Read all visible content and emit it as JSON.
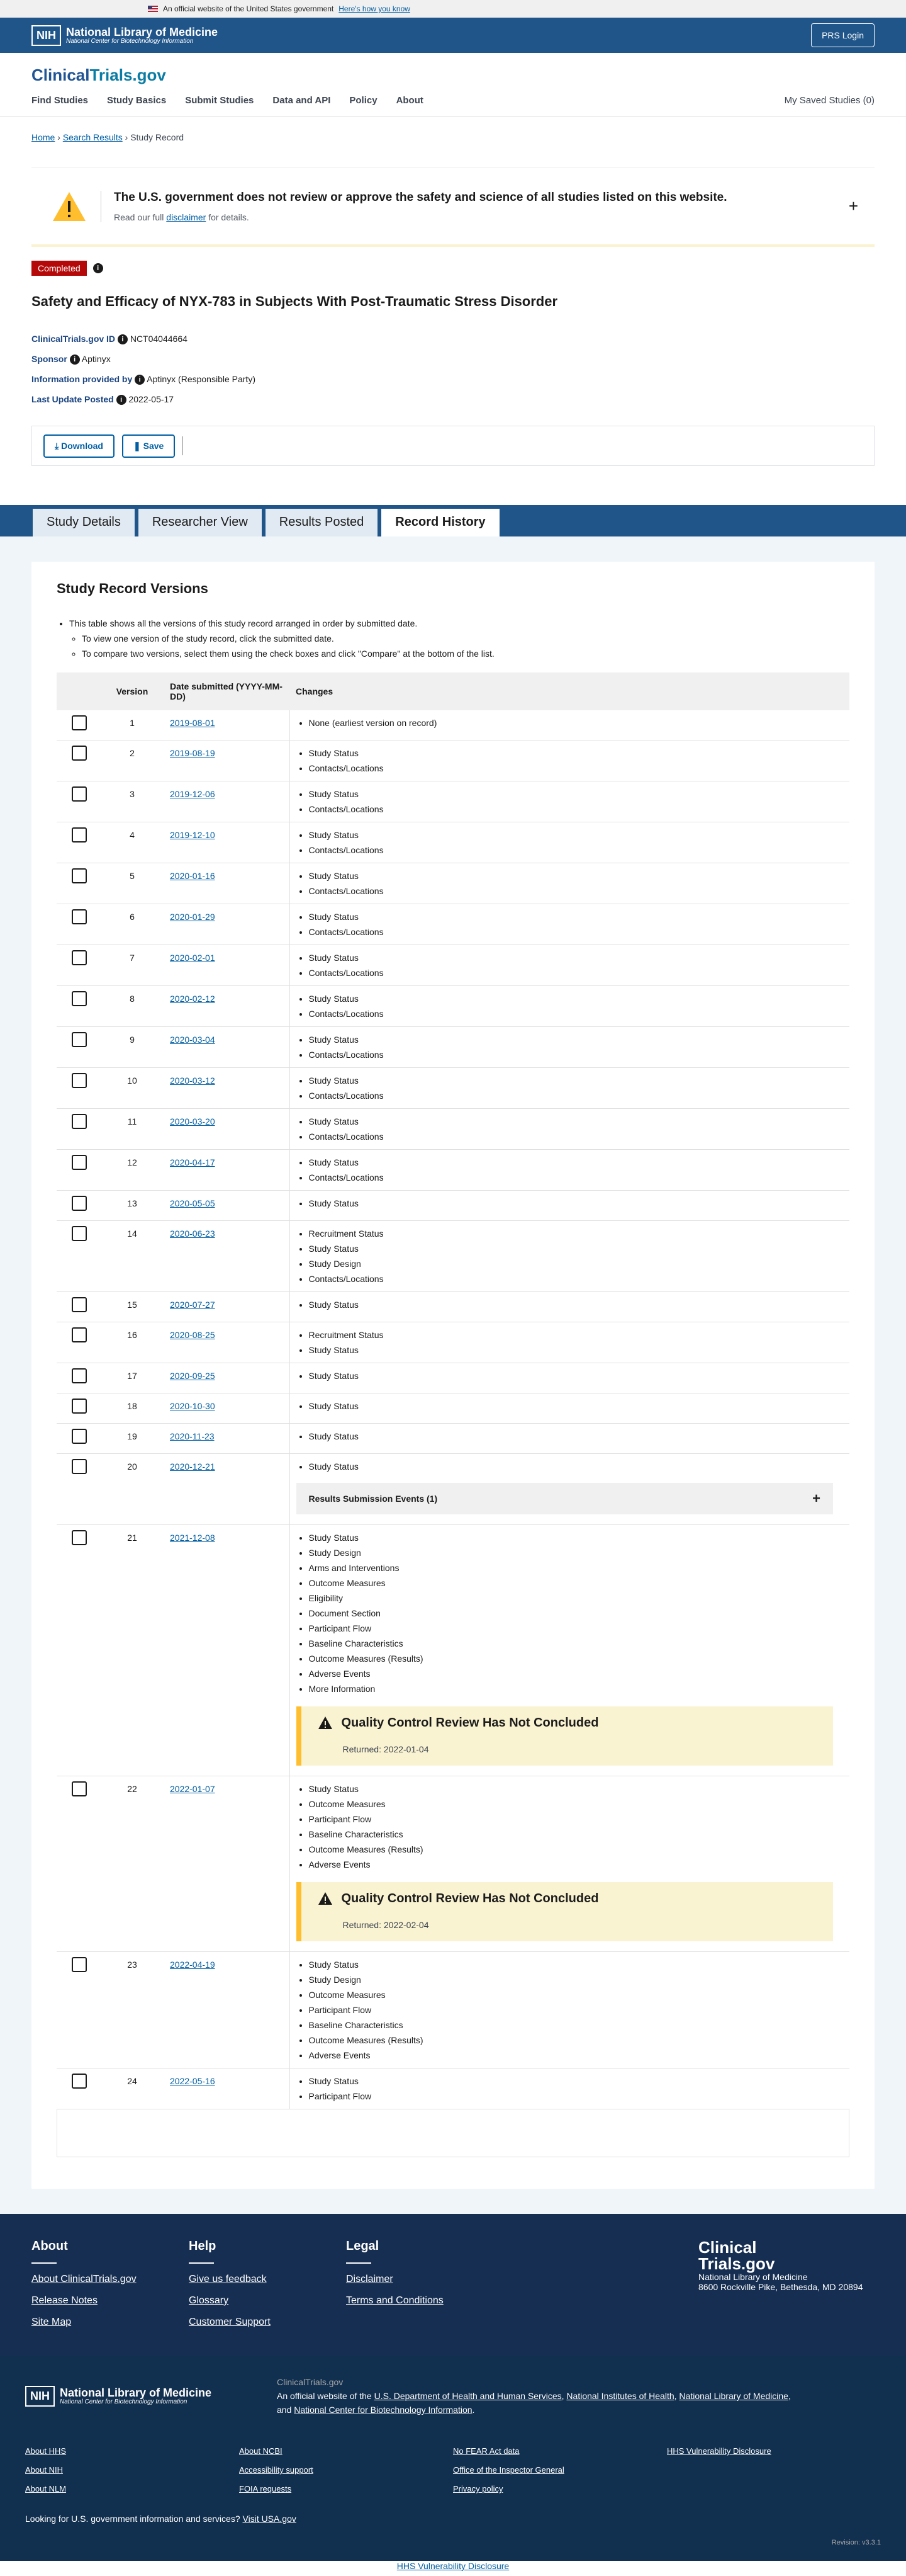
{
  "banner": {
    "text": "An official website of the United States government",
    "link": "Here's how you know"
  },
  "nlm": {
    "nih": "NIH",
    "name": "National Library of Medicine",
    "sub": "National Center for Biotechnology Information",
    "prs": "PRS Login"
  },
  "site": {
    "logo_a": "Clinical",
    "logo_b": "Trials.gov"
  },
  "nav": {
    "items": [
      "Find Studies",
      "Study Basics",
      "Submit Studies",
      "Data and API",
      "Policy",
      "About"
    ],
    "saved": "My Saved Studies (0)"
  },
  "crumbs": {
    "home": "Home",
    "search": "Search Results",
    "current": "Study Record"
  },
  "notice": {
    "title": "The U.S. government does not review or approve the safety and science of all studies listed on this website.",
    "pre": "Read our full",
    "link": "disclaimer",
    "post": "for details.",
    "plus": "+"
  },
  "status": "Completed",
  "title": "Safety and Efficacy of NYX-783 in Subjects With Post-Traumatic Stress Disorder",
  "meta": {
    "id_label": "ClinicalTrials.gov ID",
    "id": "NCT04044664",
    "sponsor_label": "Sponsor",
    "sponsor": "Aptinyx",
    "info_label": "Information provided by",
    "info": "Aptinyx (Responsible Party)",
    "update_label": "Last Update Posted",
    "update": "2022-05-17"
  },
  "actions": {
    "download": "Download",
    "save": "Save"
  },
  "tabs": [
    "Study Details",
    "Researcher View",
    "Results Posted",
    "Record History"
  ],
  "versions": {
    "heading": "Study Record Versions",
    "intro": "This table shows all the versions of this study record arranged in order by submitted date.",
    "tip1": "To view one version of the study record, click the submitted date.",
    "tip2": "To compare two versions, select them using the check boxes and click \"Compare\" at the bottom of the list.",
    "col_version": "Version",
    "col_date": "Date submitted (YYYY-MM-DD)",
    "col_changes": "Changes",
    "rse": "Results Submission Events (1)",
    "qc_title": "Quality Control Review Has Not Concluded",
    "rows": [
      {
        "v": "1",
        "d": "2019-08-01",
        "c": [
          "None (earliest version on record)"
        ]
      },
      {
        "v": "2",
        "d": "2019-08-19",
        "c": [
          "Study Status",
          "Contacts/Locations"
        ]
      },
      {
        "v": "3",
        "d": "2019-12-06",
        "c": [
          "Study Status",
          "Contacts/Locations"
        ]
      },
      {
        "v": "4",
        "d": "2019-12-10",
        "c": [
          "Study Status",
          "Contacts/Locations"
        ]
      },
      {
        "v": "5",
        "d": "2020-01-16",
        "c": [
          "Study Status",
          "Contacts/Locations"
        ]
      },
      {
        "v": "6",
        "d": "2020-01-29",
        "c": [
          "Study Status",
          "Contacts/Locations"
        ]
      },
      {
        "v": "7",
        "d": "2020-02-01",
        "c": [
          "Study Status",
          "Contacts/Locations"
        ]
      },
      {
        "v": "8",
        "d": "2020-02-12",
        "c": [
          "Study Status",
          "Contacts/Locations"
        ]
      },
      {
        "v": "9",
        "d": "2020-03-04",
        "c": [
          "Study Status",
          "Contacts/Locations"
        ]
      },
      {
        "v": "10",
        "d": "2020-03-12",
        "c": [
          "Study Status",
          "Contacts/Locations"
        ]
      },
      {
        "v": "11",
        "d": "2020-03-20",
        "c": [
          "Study Status",
          "Contacts/Locations"
        ]
      },
      {
        "v": "12",
        "d": "2020-04-17",
        "c": [
          "Study Status",
          "Contacts/Locations"
        ]
      },
      {
        "v": "13",
        "d": "2020-05-05",
        "c": [
          "Study Status"
        ]
      },
      {
        "v": "14",
        "d": "2020-06-23",
        "c": [
          "Recruitment Status",
          "Study Status",
          "Study Design",
          "Contacts/Locations"
        ]
      },
      {
        "v": "15",
        "d": "2020-07-27",
        "c": [
          "Study Status"
        ]
      },
      {
        "v": "16",
        "d": "2020-08-25",
        "c": [
          "Recruitment Status",
          "Study Status"
        ]
      },
      {
        "v": "17",
        "d": "2020-09-25",
        "c": [
          "Study Status"
        ]
      },
      {
        "v": "18",
        "d": "2020-10-30",
        "c": [
          "Study Status"
        ]
      },
      {
        "v": "19",
        "d": "2020-11-23",
        "c": [
          "Study Status"
        ]
      },
      {
        "v": "20",
        "d": "2020-12-21",
        "c": [
          "Study Status"
        ],
        "rse": true
      },
      {
        "v": "21",
        "d": "2021-12-08",
        "c": [
          "Study Status",
          "Study Design",
          "Arms and Interventions",
          "Outcome Measures",
          "Eligibility",
          "Document Section",
          "Participant Flow",
          "Baseline Characteristics",
          "Outcome Measures (Results)",
          "Adverse Events",
          "More Information"
        ],
        "qc": "Returned: 2022-01-04"
      },
      {
        "v": "22",
        "d": "2022-01-07",
        "c": [
          "Study Status",
          "Outcome Measures",
          "Participant Flow",
          "Baseline Characteristics",
          "Outcome Measures (Results)",
          "Adverse Events"
        ],
        "qc": "Returned: 2022-02-04"
      },
      {
        "v": "23",
        "d": "2022-04-19",
        "c": [
          "Study Status",
          "Study Design",
          "Outcome Measures",
          "Participant Flow",
          "Baseline Characteristics",
          "Outcome Measures (Results)",
          "Adverse Events"
        ]
      },
      {
        "v": "24",
        "d": "2022-05-16",
        "c": [
          "Study Status",
          "Participant Flow"
        ]
      }
    ]
  },
  "footer": {
    "about": "About",
    "about_links": [
      "About ClinicalTrials.gov",
      "Release Notes",
      "Site Map"
    ],
    "help": "Help",
    "help_links": [
      "Give us feedback",
      "Glossary",
      "Customer Support"
    ],
    "legal": "Legal",
    "legal_links": [
      "Disclaimer",
      "Terms and Conditions"
    ],
    "logo_a": "Clinical",
    "logo_b": "Trials.gov",
    "addr1": "National Library of Medicine",
    "addr2": "8600 Rockville Pike, Bethesda, MD 20894"
  },
  "nlmfoot": {
    "site": "ClinicalTrials.gov",
    "official_pre": "An official website of the",
    "hhs": "U.S. Department of Health and Human Services",
    "nih": "National Institutes of Health",
    "nlm": "National Library of Medicine",
    "and": "and",
    "ncbi": "National Center for Biotechnology Information",
    "col1": [
      "About HHS",
      "About NIH",
      "About NLM"
    ],
    "col2": [
      "About NCBI",
      "Accessibility support",
      "FOIA requests"
    ],
    "col3": [
      "No FEAR Act data",
      "Office of the Inspector General",
      "Privacy policy"
    ],
    "col4": [
      "HHS Vulnerability Disclosure"
    ],
    "usa_text": "Looking for U.S. government information and services?",
    "usa_link": "Visit USA.gov",
    "version": "Revision: v3.3.1",
    "bottom": "HHS Vulnerability Disclosure"
  }
}
